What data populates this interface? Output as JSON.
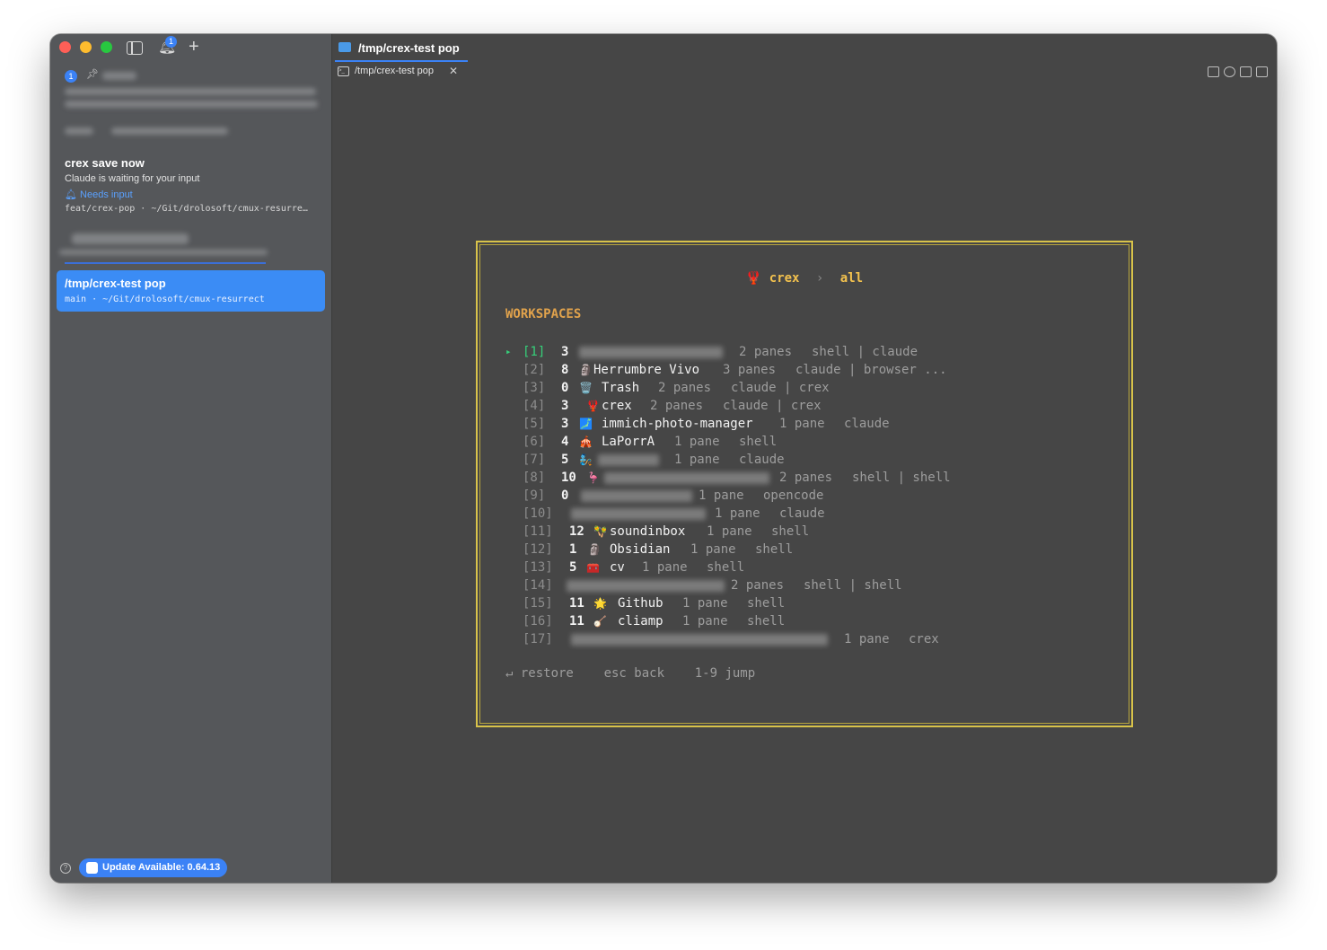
{
  "sidebar": {
    "notification_count": "1",
    "workspace_badge": "1",
    "workspace2": {
      "title": "crex save now",
      "subtitle": "Claude is waiting for your input",
      "status": "Needs input",
      "path": "feat/crex-pop · ~/Git/drolosoft/cmux-resurre…"
    },
    "active_workspace": {
      "title": "/tmp/crex-test pop",
      "path": "main · ~/Git/drolosoft/cmux-resurrect"
    },
    "update_label": "Update Available: 0.64.13",
    "help_glyph": "?"
  },
  "main": {
    "title": "/tmp/crex-test pop",
    "tab_label": "/tmp/crex-test pop"
  },
  "terminal": {
    "breadcrumb": {
      "icon": "🦞",
      "app": "crex",
      "separator": "›",
      "scope": "all"
    },
    "section_title": "WORKSPACES",
    "rows": [
      {
        "idx": "[1]",
        "count": "3",
        "emoji": "",
        "name": "",
        "panes": "2 panes",
        "kinds": "shell | claude"
      },
      {
        "idx": "[2]",
        "count": "8",
        "emoji": "🗿",
        "name": "Herrumbre Vivo",
        "panes": "3 panes",
        "kinds": "claude | browser ..."
      },
      {
        "idx": "[3]",
        "count": "0",
        "emoji": "🗑️",
        "name": "Trash",
        "panes": "2 panes",
        "kinds": "claude | crex"
      },
      {
        "idx": "[4]",
        "count": "3",
        "emoji": "🦞",
        "name": "crex",
        "panes": "2 panes",
        "kinds": "claude | crex"
      },
      {
        "idx": "[5]",
        "count": "3",
        "emoji": "🗾",
        "name": "immich-photo-manager",
        "panes": "1 pane",
        "kinds": "claude"
      },
      {
        "idx": "[6]",
        "count": "4",
        "emoji": "🎪",
        "name": "LaPorrA",
        "panes": "1 pane",
        "kinds": "shell"
      },
      {
        "idx": "[7]",
        "count": "5",
        "emoji": "🧞",
        "name": "",
        "panes": "1 pane",
        "kinds": "claude"
      },
      {
        "idx": "[8]",
        "count": "10",
        "emoji": "🦩",
        "name": "",
        "panes": "2 panes",
        "kinds": "shell | shell"
      },
      {
        "idx": "[9]",
        "count": "0",
        "emoji": "",
        "name": "",
        "panes": "1 pane",
        "kinds": "opencode"
      },
      {
        "idx": "[10]",
        "count": "",
        "emoji": "",
        "name": "",
        "panes": "1 pane",
        "kinds": "claude"
      },
      {
        "idx": "[11]",
        "count": "12",
        "emoji": "🪇",
        "name": "soundinbox",
        "panes": "1 pane",
        "kinds": "shell"
      },
      {
        "idx": "[12]",
        "count": "1",
        "emoji": "🗿",
        "name": "Obsidian",
        "panes": "1 pane",
        "kinds": "shell"
      },
      {
        "idx": "[13]",
        "count": "5",
        "emoji": "🧰",
        "name": "cv",
        "panes": "1 pane",
        "kinds": "shell"
      },
      {
        "idx": "[14]",
        "count": "",
        "emoji": "",
        "name": "",
        "panes": "2 panes",
        "kinds": "shell | shell"
      },
      {
        "idx": "[15]",
        "count": "11",
        "emoji": "🌟",
        "name": "Github",
        "panes": "1 pane",
        "kinds": "shell"
      },
      {
        "idx": "[16]",
        "count": "11",
        "emoji": "🪕",
        "name": "cliamp",
        "panes": "1 pane",
        "kinds": "shell"
      },
      {
        "idx": "[17]",
        "count": "",
        "emoji": "",
        "name": "",
        "panes": "1 pane",
        "kinds": "crex"
      }
    ],
    "footer": {
      "restore": "↵ restore",
      "back": "esc back",
      "jump": "1-9 jump"
    }
  },
  "colors": {
    "accent": "#3b82f6",
    "panel_border": "#d8c34a",
    "heading": "#e0a24c",
    "selected": "#36d07a"
  }
}
